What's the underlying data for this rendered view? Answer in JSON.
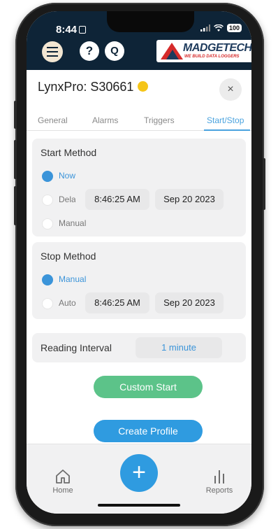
{
  "status_bar": {
    "time": "8:44",
    "battery": "100"
  },
  "header": {
    "help_label": "?",
    "q_label": "Q",
    "logo_text": "MADGETECH",
    "logo_tagline": "WE BUILD DATA LOGGERS",
    "accent_color": "#0e2437"
  },
  "device": {
    "title": "LynxPro: S30661",
    "status_color": "#f5c518",
    "close_label": "×"
  },
  "tabs": [
    {
      "label": "General"
    },
    {
      "label": "Alarms"
    },
    {
      "label": "Triggers"
    },
    {
      "label": "Start/Stop",
      "active": true
    }
  ],
  "start_method": {
    "title": "Start Method",
    "options": [
      {
        "label": "Now",
        "selected": true
      },
      {
        "label": "Delay",
        "selected": false
      },
      {
        "label": "Manual",
        "selected": false
      }
    ],
    "time": "8:46:25 AM",
    "date": "Sep 20 2023"
  },
  "stop_method": {
    "title": "Stop Method",
    "options": [
      {
        "label": "Manual",
        "selected": true
      },
      {
        "label": "Auto",
        "selected": false
      }
    ],
    "time": "8:46:25 AM",
    "date": "Sep 20 2023"
  },
  "reading_interval": {
    "label": "Reading Interval",
    "value": "1 minute"
  },
  "buttons": {
    "custom_start": "Custom Start",
    "create_profile": "Create Profile",
    "custom_start_color": "#5cc389",
    "create_profile_color": "#2f9be0"
  },
  "bottom_nav": {
    "home": "Home",
    "add": "+",
    "reports": "Reports"
  }
}
